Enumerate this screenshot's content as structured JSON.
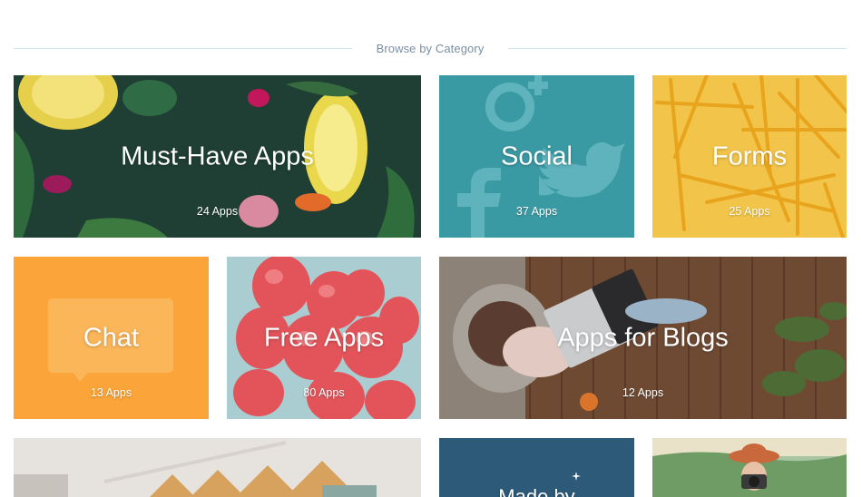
{
  "section": {
    "heading": "Browse by Category"
  },
  "tiles": [
    {
      "title": "Must-Have Apps",
      "count": "24 Apps"
    },
    {
      "title": "Social",
      "count": "37 Apps"
    },
    {
      "title": "Forms",
      "count": "25 Apps"
    },
    {
      "title": "Chat",
      "count": "13 Apps"
    },
    {
      "title": "Free Apps",
      "count": "80 Apps"
    },
    {
      "title": "Apps for Blogs",
      "count": "12 Apps"
    },
    {
      "title": "",
      "count": ""
    },
    {
      "title": "Made by",
      "count": ""
    },
    {
      "title": "",
      "count": ""
    }
  ],
  "colors": {
    "social": "#3a9aa4",
    "forms": "#f2c54a",
    "chat": "#fba43a",
    "free": "#a9cdd1",
    "made": "#2c5a78",
    "heading_line": "#cfe3ec",
    "heading_text": "#7a8fa3"
  },
  "icons": [
    "google-plus-icon",
    "twitter-bird-icon",
    "facebook-icon",
    "speech-bubble-icon",
    "sparkle-icon"
  ]
}
